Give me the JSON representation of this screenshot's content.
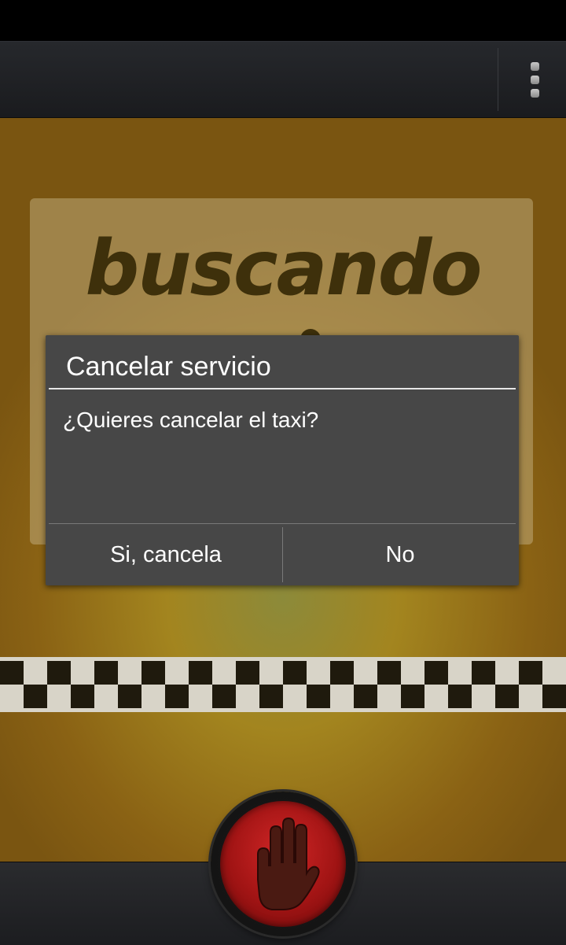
{
  "app": {
    "brand_text": "buscando"
  },
  "action_bar": {
    "overflow_menu_icon": "overflow-menu-icon"
  },
  "dialog": {
    "title": "Cancelar servicio",
    "message": "¿Quieres cancelar el taxi?",
    "positive_label": "Si, cancela",
    "negative_label": "No"
  },
  "bottom": {
    "stop_icon": "hand-stop-icon"
  },
  "colors": {
    "background_gold": "#a3851f",
    "dialog_bg": "#474747",
    "stop_red": "#c01c1c"
  }
}
